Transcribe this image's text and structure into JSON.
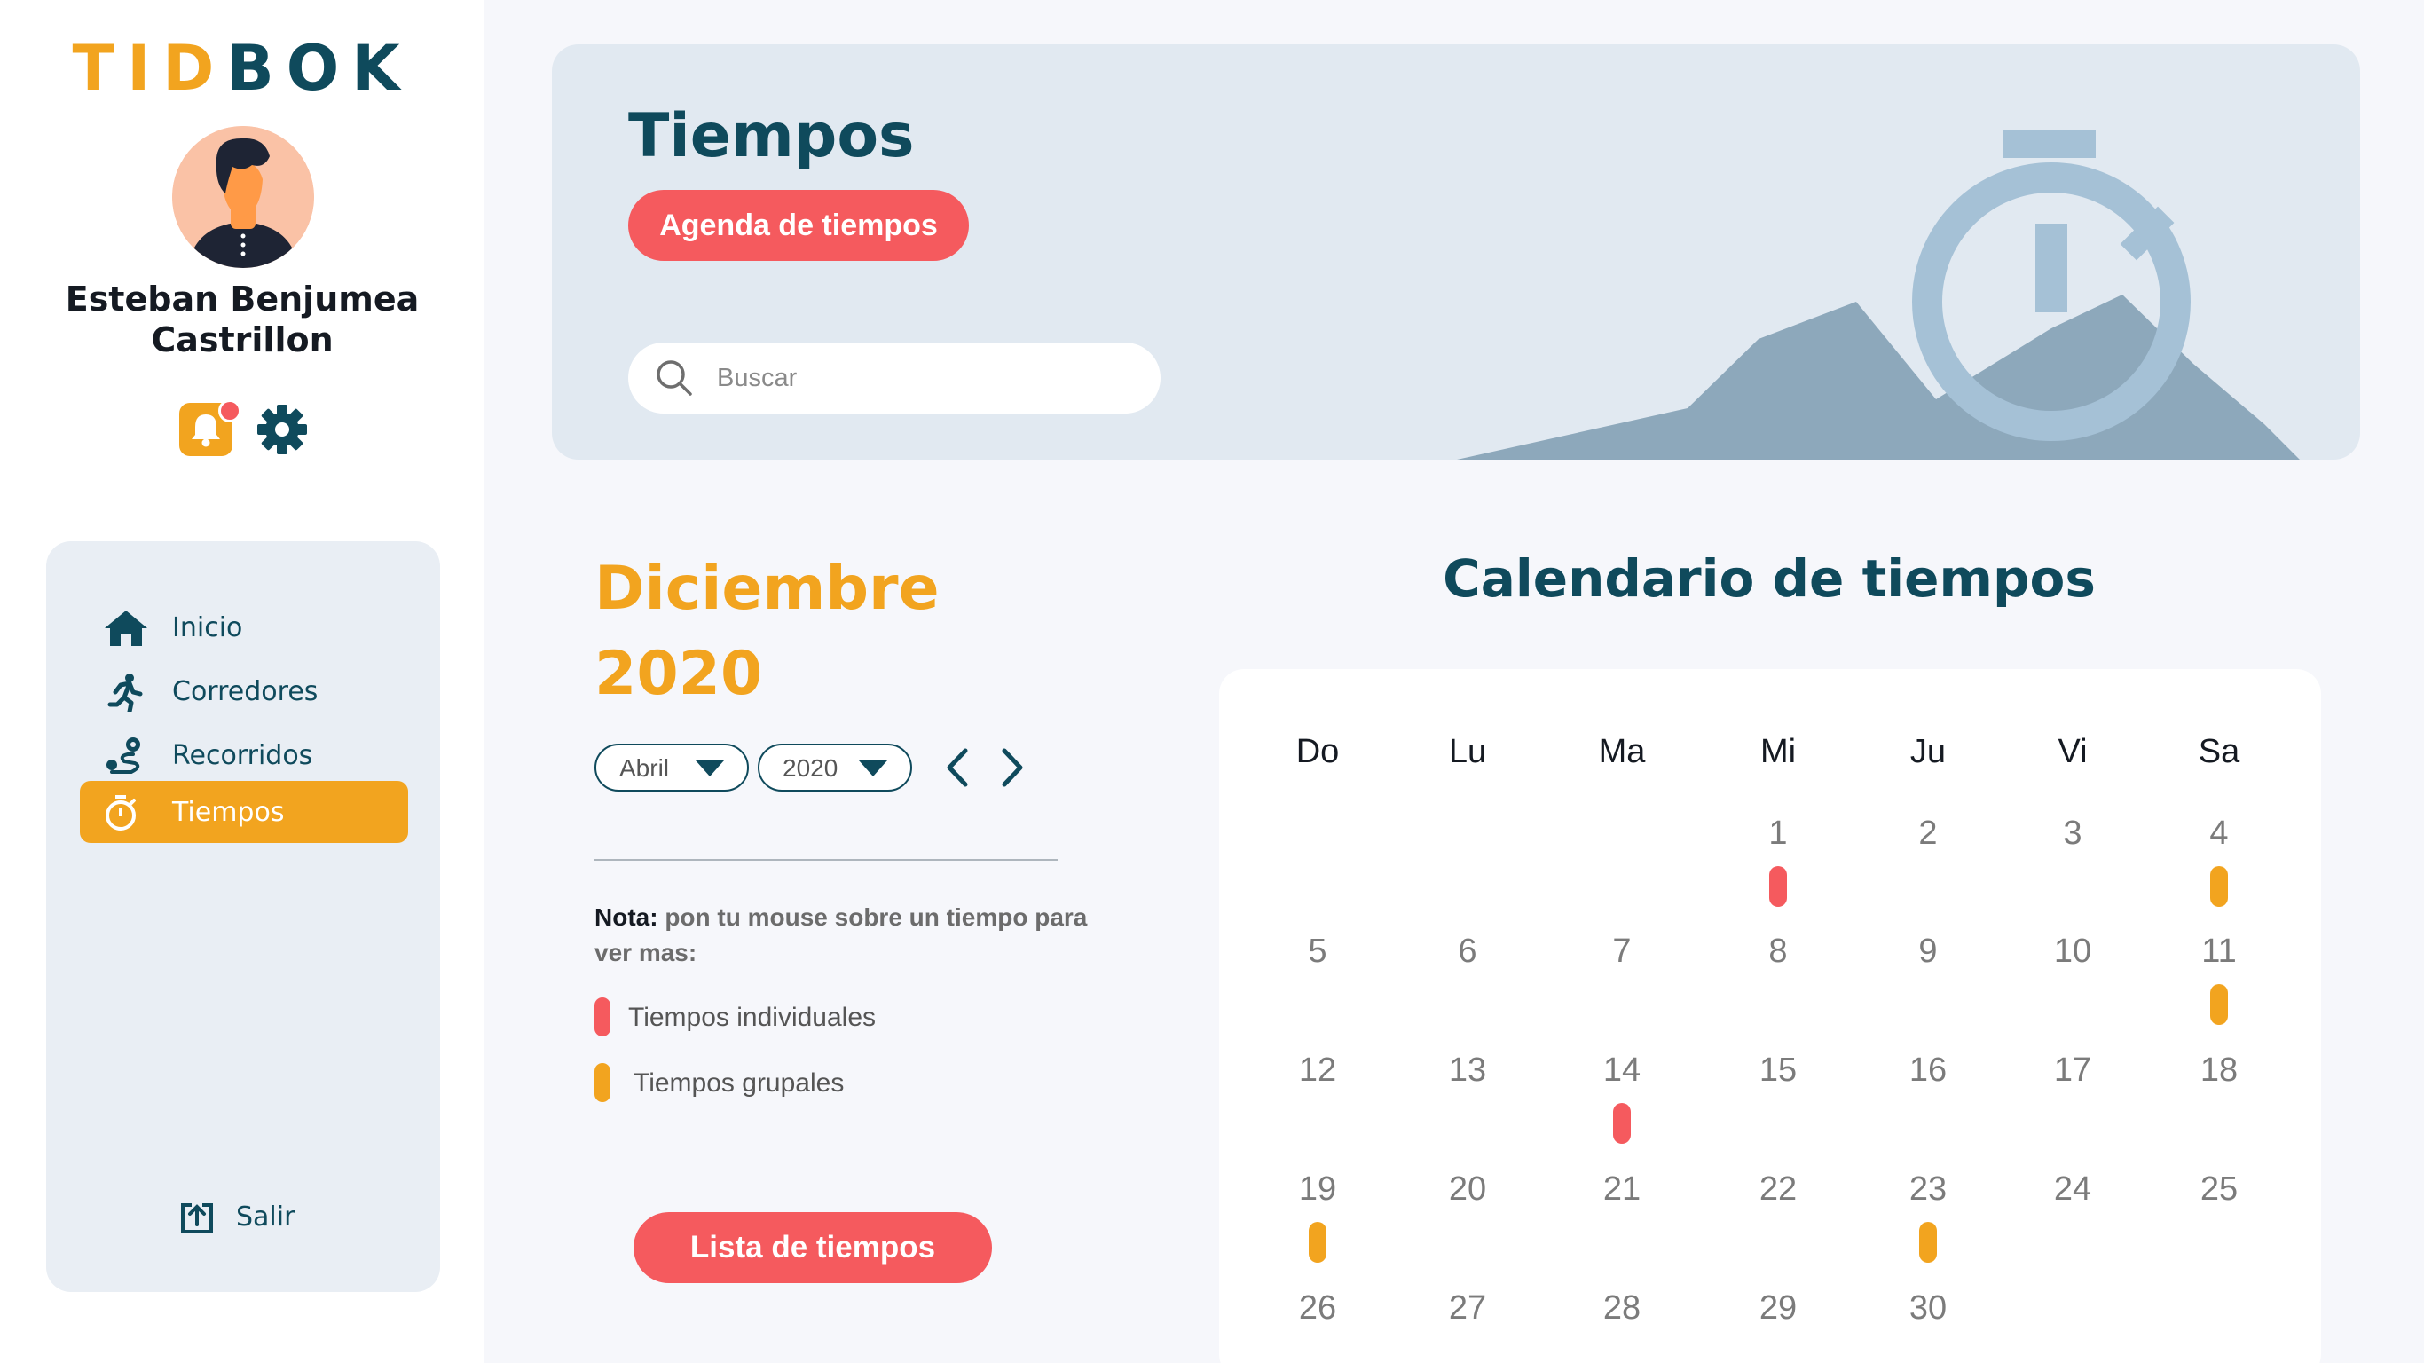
{
  "app": {
    "logo_part1": "TID",
    "logo_part2": "BOK"
  },
  "user": {
    "name_line1": "Esteban Benjumea",
    "name_line2": "Castrillon"
  },
  "sidebar": {
    "items": [
      {
        "label": "Inicio",
        "icon": "home-icon"
      },
      {
        "label": "Corredores",
        "icon": "runner-icon"
      },
      {
        "label": "Recorridos",
        "icon": "route-icon"
      },
      {
        "label": "Tiempos",
        "icon": "stopwatch-icon",
        "active": true
      }
    ],
    "logout_label": "Salir"
  },
  "header": {
    "title": "Tiempos",
    "agenda_button": "Agenda de tiempos",
    "search_placeholder": "Buscar"
  },
  "month_panel": {
    "month": "Diciembre",
    "year": "2020",
    "month_select": "Abril",
    "year_select": "2020",
    "note_bold": "Nota:",
    "note_text": " pon tu mouse sobre un tiempo para ver mas:",
    "legend": [
      {
        "label": "Tiempos individuales",
        "color": "#f55a5e"
      },
      {
        "label": "Tiempos grupales",
        "color": "#f2a41f"
      }
    ],
    "list_button": "Lista de tiempos"
  },
  "calendar": {
    "title": "Calendario de tiempos",
    "weekdays": [
      "Do",
      "Lu",
      "Ma",
      "Mi",
      "Ju",
      "Vi",
      "Sa"
    ],
    "first_weekday_index": 3,
    "days_in_month": 30,
    "days": [
      "1",
      "2",
      "3",
      "4",
      "5",
      "6",
      "7",
      "8",
      "9",
      "10",
      "11",
      "12",
      "13",
      "14",
      "15",
      "16",
      "17",
      "18",
      "19",
      "20",
      "21",
      "22",
      "23",
      "24",
      "25",
      "26",
      "27",
      "28",
      "29",
      "30"
    ],
    "markers": [
      {
        "day": 1,
        "type": "individual"
      },
      {
        "day": 4,
        "type": "group"
      },
      {
        "day": 11,
        "type": "group"
      },
      {
        "day": 14,
        "type": "individual"
      },
      {
        "day": 19,
        "type": "group"
      },
      {
        "day": 23,
        "type": "group"
      }
    ]
  },
  "colors": {
    "primary": "#0f4a5c",
    "accent_orange": "#f2a41f",
    "accent_red": "#f55a5e",
    "hero_bg": "#e1e9f1"
  }
}
